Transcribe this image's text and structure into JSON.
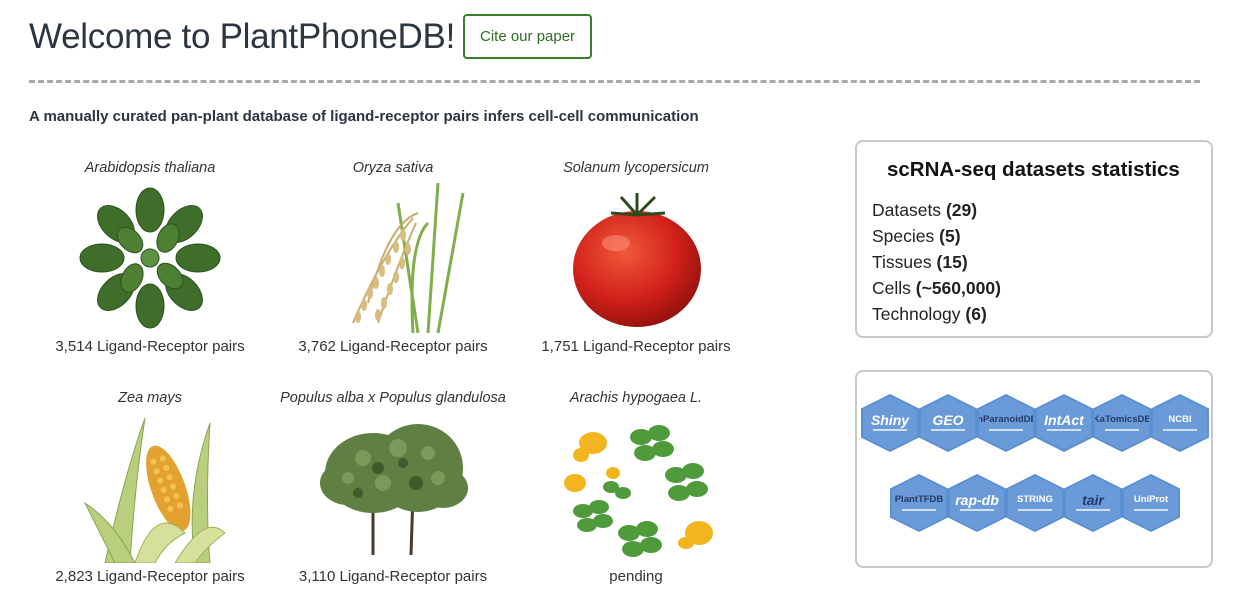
{
  "header": {
    "title": "Welcome to PlantPhoneDB!",
    "cite_label": "Cite our paper",
    "subtitle": "A manually curated pan-plant database of ligand-receptor pairs infers cell-cell communication"
  },
  "species": [
    {
      "name": "Arabidopsis thaliana",
      "pairs": "3,514 Ligand-Receptor pairs",
      "icon": "arabidopsis-image"
    },
    {
      "name": "Oryza sativa",
      "pairs": "3,762 Ligand-Receptor pairs",
      "icon": "rice-image"
    },
    {
      "name": "Solanum lycopersicum",
      "pairs": "1,751 Ligand-Receptor pairs",
      "icon": "tomato-image"
    },
    {
      "name": "Zea mays",
      "pairs": "2,823 Ligand-Receptor pairs",
      "icon": "corn-image"
    },
    {
      "name": "Populus alba x Populus glandulosa",
      "pairs": "3,110 Ligand-Receptor pairs",
      "icon": "tree-image"
    },
    {
      "name": "Arachis hypogaea L.",
      "pairs": "pending",
      "icon": "peanut-image"
    }
  ],
  "stats": {
    "title": "scRNA-seq datasets statistics",
    "items": [
      {
        "label": "Datasets",
        "value": "(29)"
      },
      {
        "label": "Species",
        "value": "(5)"
      },
      {
        "label": "Tissues",
        "value": "(15)"
      },
      {
        "label": "Cells",
        "value": "(~560,000)"
      },
      {
        "label": "Technology",
        "value": "(6)"
      }
    ]
  },
  "tools": [
    {
      "label": "Shiny"
    },
    {
      "label": "GEO"
    },
    {
      "label": "InParanoidDB"
    },
    {
      "label": "IntAct"
    },
    {
      "label": "KaTomicsDB"
    },
    {
      "label": "NCBI"
    },
    {
      "label": "PlantTFDB"
    },
    {
      "label": "rap-db"
    },
    {
      "label": "STRING"
    },
    {
      "label": "tair"
    },
    {
      "label": "UniProt"
    }
  ],
  "colors": {
    "cite_border": "#3a7d2c",
    "hex_fill": "#5a8fd1",
    "divider": "#a9a9a9"
  }
}
